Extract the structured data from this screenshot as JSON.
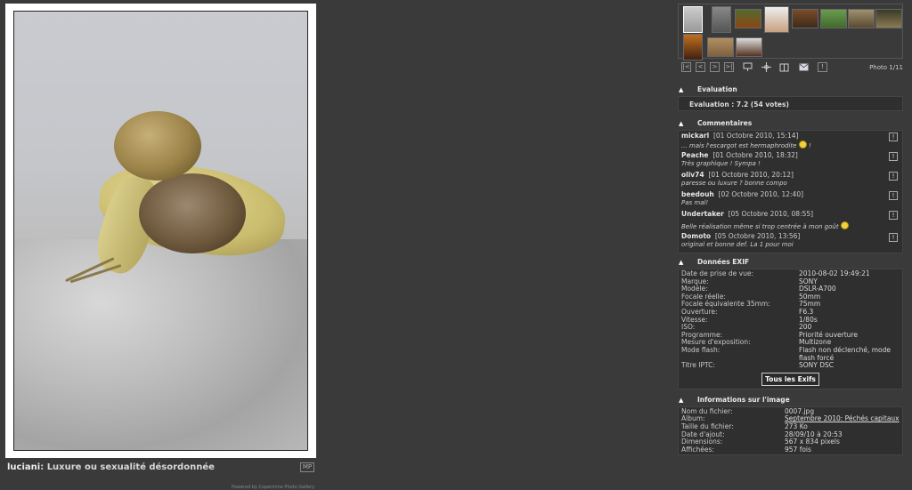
{
  "photo": {
    "author": "luciani",
    "title": "Luxure ou sexualité désordonnée",
    "mp_label": "MP"
  },
  "footer": {
    "powered": "Powered by Copermine Photo Gallery"
  },
  "nav": {
    "photo_count": "Photo 1/11",
    "buttons": [
      "|<",
      "<",
      ">",
      ">|"
    ],
    "icons": [
      "slideshow-icon",
      "settings-icon",
      "book-icon",
      "email-icon",
      "info-icon"
    ]
  },
  "sections": {
    "evaluation_title": "Evaluation",
    "evaluation_value": "Evaluation : 7.2 (54 votes)",
    "comments_title": "Commentaires",
    "exif_title": "Données EXIF",
    "info_title": "Informations sur l'image"
  },
  "comments": [
    {
      "user": "mickarl",
      "date": "[01 Octobre 2010, 15:14]",
      "text": "... mais l'escargot est hermaphrodite",
      "suffix": "!"
    },
    {
      "user": "Peache",
      "date": "[01 Octobre 2010, 18:32]",
      "text": "Très graphique ! Sympa !",
      "suffix": ""
    },
    {
      "user": "oliv74",
      "date": "[01 Octobre 2010, 20:12]",
      "text": "paresse ou luxure ? bonne compo",
      "suffix": ""
    },
    {
      "user": "beedouh",
      "date": "[02 Octobre 2010, 12:40]",
      "text": "Pas mal!",
      "suffix": ""
    },
    {
      "user": "Undertaker",
      "date": "[05 Octobre 2010, 08:55]",
      "text": "Belle réalisation même si trop centrée à mon goût",
      "suffix": ""
    },
    {
      "user": "Domoto",
      "date": "[05 Octobre 2010, 13:56]",
      "text": "original et bonne def. La 1 pour moi",
      "suffix": ""
    }
  ],
  "exif": [
    {
      "k": "Date de prise de vue:",
      "v": "2010-08-02 19:49:21"
    },
    {
      "k": "Marque:",
      "v": "SONY"
    },
    {
      "k": "Modèle:",
      "v": "DSLR-A700"
    },
    {
      "k": "Focale réelle:",
      "v": "50mm"
    },
    {
      "k": "Focale équivalente 35mm:",
      "v": "75mm"
    },
    {
      "k": "Ouverture:",
      "v": "F6.3"
    },
    {
      "k": "Vitesse:",
      "v": "1/80s"
    },
    {
      "k": "ISO:",
      "v": "200"
    },
    {
      "k": "Programme:",
      "v": "Priorité ouverture"
    },
    {
      "k": "Mesure d'exposition:",
      "v": "Multizone"
    },
    {
      "k": "Mode flash:",
      "v": "Flash non déclenché, mode flash forcé"
    },
    {
      "k": "Titre IPTC:",
      "v": "SONY DSC"
    }
  ],
  "exif_button": "Tous les Exifs",
  "info": [
    {
      "k": "Nom du fichier:",
      "v": "0007.jpg",
      "link": false
    },
    {
      "k": "Album:",
      "v": "Septembre 2010: Péchés capitaux",
      "link": true
    },
    {
      "k": "Taille du fichier:",
      "v": "273 Ko",
      "link": false
    },
    {
      "k": "Date d'ajout:",
      "v": "28/09/10 à 20:53",
      "link": false
    },
    {
      "k": "Dimensions:",
      "v": "567 x 834 pixels",
      "link": false
    },
    {
      "k": "Affichées:",
      "v": "957 fois",
      "link": false
    }
  ],
  "colors": {
    "background": "#3a3a3a",
    "box": "#2f2f2f"
  }
}
